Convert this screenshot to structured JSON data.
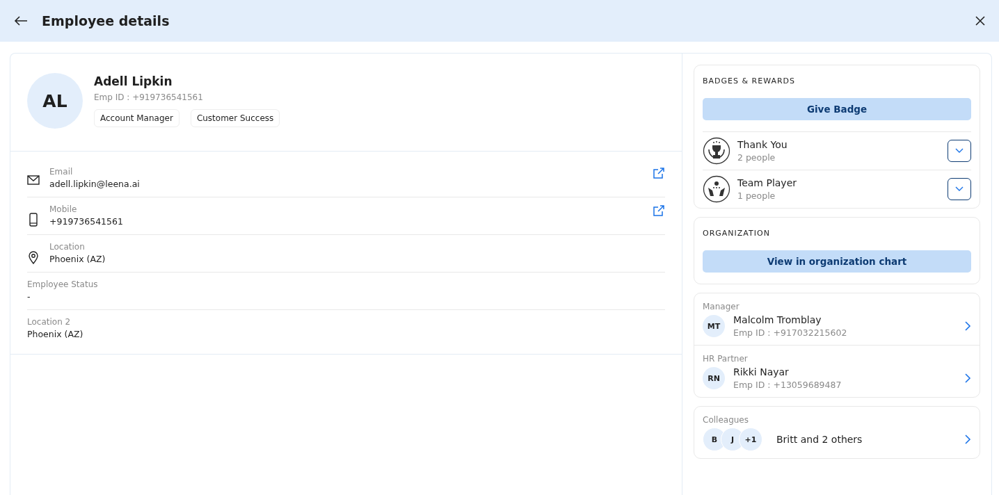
{
  "header": {
    "title": "Employee details"
  },
  "profile": {
    "initials": "AL",
    "name": "Adell Lipkin",
    "emp_id": "Emp ID : +919736541561",
    "tags": [
      "Account Manager",
      "Customer Success"
    ]
  },
  "fields": [
    {
      "kind": "email",
      "label": "Email",
      "value": "adell.lipkin@leena.ai",
      "external_link": true
    },
    {
      "kind": "mobile",
      "label": "Mobile",
      "value": "+919736541561",
      "external_link": true
    },
    {
      "kind": "location",
      "label": "Location",
      "value": "Phoenix (AZ)",
      "external_link": false
    },
    {
      "kind": "plain",
      "label": "Employee Status",
      "value": "-",
      "external_link": false
    },
    {
      "kind": "plain",
      "label": "Location 2",
      "value": "Phoenix (AZ)",
      "external_link": false
    }
  ],
  "badges": {
    "title": "BADGES & REWARDS",
    "button": "Give Badge",
    "items": [
      {
        "kind": "trophy",
        "name": "Thank You",
        "count": "2 people"
      },
      {
        "kind": "hands",
        "name": "Team Player",
        "count": "1 people"
      }
    ]
  },
  "organization": {
    "title": "ORGANIZATION",
    "button": "View in organization chart"
  },
  "people": [
    {
      "role": "Manager",
      "initials": "MT",
      "name": "Malcolm Tromblay",
      "emp_id": "Emp ID : +917032215602"
    },
    {
      "role": "HR Partner",
      "initials": "RN",
      "name": "Rikki Nayar",
      "emp_id": "Emp ID : +13059689487"
    }
  ],
  "colleagues": {
    "title": "Colleagues",
    "avatars": [
      "B",
      "J",
      "+1"
    ],
    "summary": "Britt and 2 others"
  }
}
